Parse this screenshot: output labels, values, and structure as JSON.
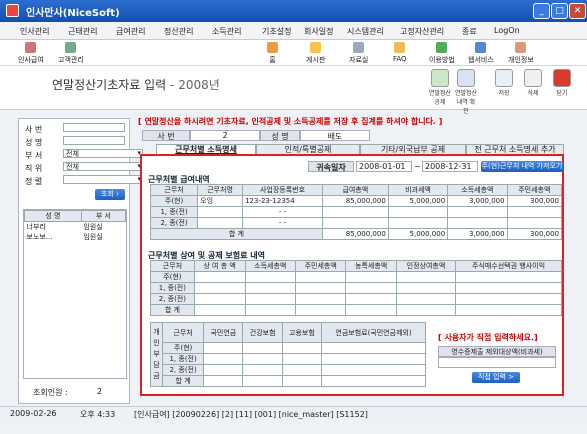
{
  "app": {
    "title": "인사만사(NiceSoft)"
  },
  "menu": [
    "인사관리",
    "근태관리",
    "급여관리",
    "정산관리",
    "소득관리",
    "기초설정",
    "회사일정",
    "시스템관리",
    "고정자산관리",
    "종료",
    "LogOn"
  ],
  "toolbar_left": [
    "인사급여",
    "고객관리"
  ],
  "toolbar_right": [
    "홈",
    "게시판",
    "자료실",
    "FAQ",
    "이용방법",
    "웹서비스",
    "개인정보"
  ],
  "page": {
    "title": "연말정산기초자료 입력",
    "year": "- 2008년"
  },
  "actions": [
    "연말정산 공제",
    "연말정산내역 확 인",
    "저장",
    "삭제",
    "닫기"
  ],
  "left": {
    "labels": [
      "사 번",
      "성 명",
      "부 서",
      "직 위",
      "정 렬"
    ],
    "values": [
      "",
      "",
      "전체",
      "전체",
      ""
    ],
    "search": "조회",
    "grid_headers": [
      "성 명",
      "부 서"
    ],
    "rows": [
      [
        "너부리",
        "임원실"
      ],
      [
        "보노보...",
        "임원실"
      ]
    ],
    "count_label": "조회인원 :",
    "count": "2"
  },
  "notice": "[ 연말정산을 하시려면 기초자료, 인적공제 및 소득공제를 저장 후 집계를 하셔야 합니다. ]",
  "emp": {
    "no_label": "사 번",
    "no": "2",
    "name_label": "성 명",
    "name": "배도"
  },
  "tabs": [
    "근무처별 소득명세",
    "인적/특별공제",
    "기타/외국납부 공제",
    "전 근무처 소득명세 추가"
  ],
  "period": {
    "label": "귀속일자",
    "from": "2008-01-01",
    "sep": "~",
    "to": "2008-12-31",
    "button": "주(현)근무처 내역 가져오기"
  },
  "s1": {
    "title": "근무처별 급여내역",
    "headers": [
      "근무처",
      "근무처명",
      "사업장등록번호",
      "급여총액",
      "비과세액",
      "소득세총액",
      "주민세총액"
    ],
    "rows": [
      [
        "주(현)",
        "오잉",
        "123-23-12354",
        "85,000,000",
        "5,000,000",
        "3,000,000",
        "300,000"
      ],
      [
        "1, 종(전)",
        "",
        "- -",
        "",
        "",
        "",
        ""
      ],
      [
        "2, 종(전)",
        "",
        "- -",
        "",
        "",
        "",
        ""
      ],
      [
        "합 계",
        "",
        "",
        "85,000,000",
        "5,000,000",
        "3,000,000",
        "300,000"
      ]
    ]
  },
  "s2": {
    "title": "근무처별 상여 및 공제 보험료 내역",
    "headers": [
      "근무처",
      "상 여 총 액",
      "소득세총액",
      "주민세총액",
      "농특세총액",
      "인정상여총액",
      "주식매수선택권 행사이익"
    ],
    "rows": [
      "주(현)",
      "1, 종(전)",
      "2, 종(전)",
      "합 계"
    ]
  },
  "s3": {
    "side": "개인부담금",
    "headers": [
      "근무처",
      "국민연금",
      "건강보험",
      "고용보험",
      "연금보험료(국민연금제외)"
    ],
    "rows": [
      "주(현)",
      "1, 종(전)",
      "2, 종(전)",
      "합 계"
    ]
  },
  "direct": {
    "title": "[ 사용자가 직접 입력하세요.]",
    "label": "영수증제출 제외대상액(비과세)",
    "button": "직접 입력 >"
  },
  "status": [
    "2009-02-26",
    "오후 4:33",
    "[인사급여] [20090226] [2] [11] [001] [nice_master] [S1152]"
  ]
}
